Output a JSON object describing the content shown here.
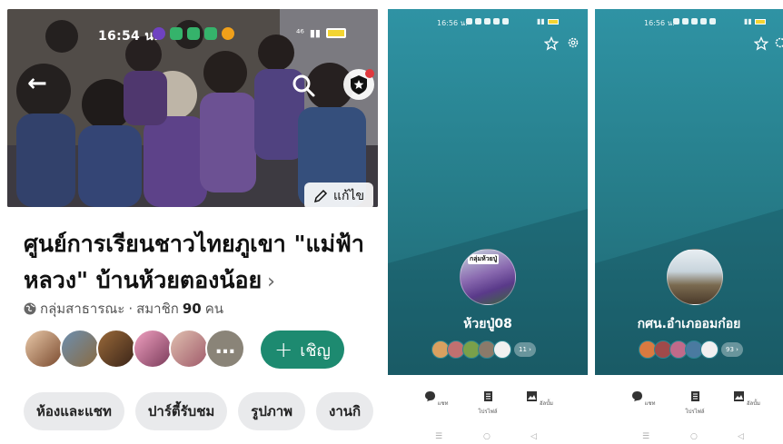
{
  "panel1": {
    "status_bar": {
      "time": "16:54 น.",
      "signal_text": "⁴⁶",
      "app_icon_colors": [
        "#6f42c1",
        "#35b36b",
        "#35b36b",
        "#35b36b",
        "#f0a01a"
      ]
    },
    "icons": {
      "back": "back-arrow-icon",
      "search": "search-icon",
      "shield": "shield-star-icon",
      "edit": "pencil-icon",
      "globe": "globe-icon"
    },
    "edit_label": "แก้ไข",
    "group_title": "ศูนย์การเรียนชาวไทยภูเขา \"แม่ฟ้าหลวง\" บ้านห้วยตองน้อย",
    "chevron": "›",
    "meta": {
      "privacy": "กลุ่มสาธารณะ",
      "separator": " · ",
      "members_label": "สมาชิก",
      "members_count": "90",
      "members_unit": "คน"
    },
    "member_avatars": [
      "member-1",
      "member-2",
      "member-3",
      "member-4",
      "member-5"
    ],
    "more_members": "…",
    "invite_label": "เชิญ",
    "tabs": [
      "ห้องและแชท",
      "ปาร์ตี้รับชม",
      "รูปภาพ",
      "งานกิ"
    ]
  },
  "panel2": {
    "status_time": "16:56 น.",
    "profile_pic_label": "กลุ่มห้วยปู่",
    "name": "ห้วยปู่08",
    "friend_count": "11",
    "actions": [
      "แชท",
      "โปรไฟล์",
      "อัลบั้ม"
    ]
  },
  "panel3": {
    "status_time": "16:56 น.",
    "name": "กศน.อำเภออมก๋อย",
    "friend_count": "93",
    "actions": [
      "แชท",
      "โปรไฟล์",
      "อัลบั้ม"
    ]
  },
  "colors": {
    "accent_green": "#1d8a70",
    "line_teal": "#2f93a4",
    "tab_bg": "#e9eaec"
  }
}
